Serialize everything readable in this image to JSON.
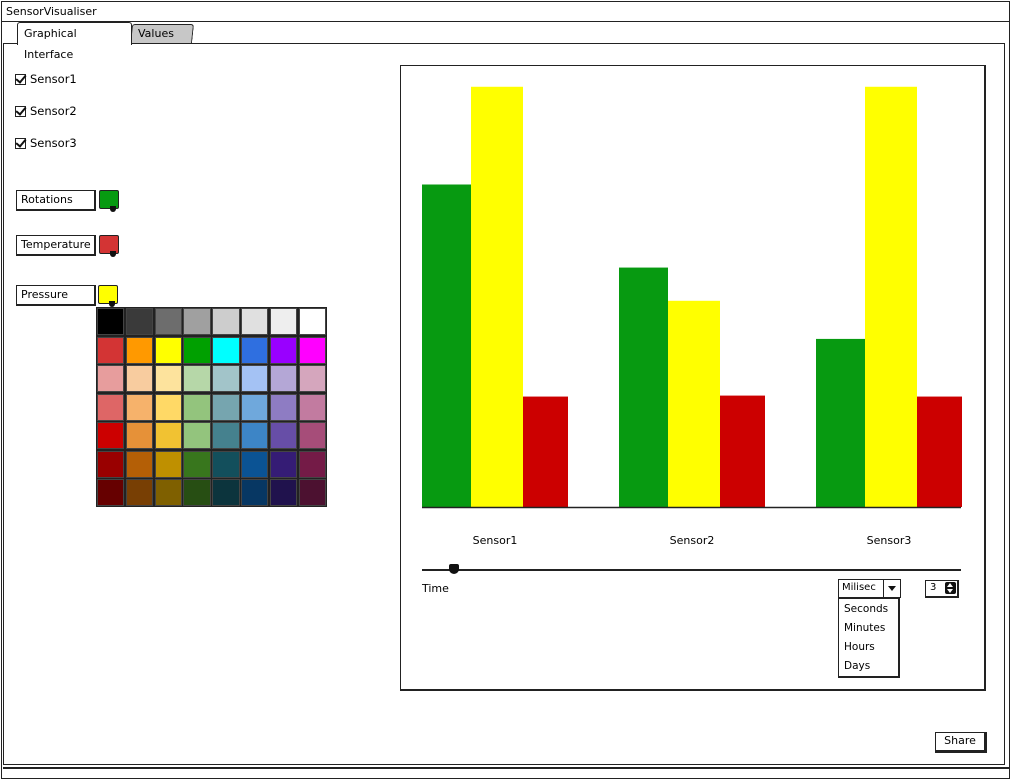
{
  "window": {
    "title": "SensorVisualiser"
  },
  "tabs": [
    {
      "label": "Graphical Interface",
      "active": true
    },
    {
      "label": "Values",
      "active": false
    }
  ],
  "sensors": [
    {
      "label": "Sensor1",
      "checked": true
    },
    {
      "label": "Sensor2",
      "checked": true
    },
    {
      "label": "Sensor3",
      "checked": true
    }
  ],
  "measures": [
    {
      "label": "Rotations",
      "color": "#079a11"
    },
    {
      "label": "Temperature",
      "color": "#d33434"
    },
    {
      "label": "Pressure",
      "color": "#ffff00"
    }
  ],
  "palette": [
    [
      "#000000",
      "#3a3a3a",
      "#6d6d6d",
      "#a0a0a0",
      "#cdcdcd",
      "#e0e0e0",
      "#eeeeee",
      "#ffffff"
    ],
    [
      "#d33434",
      "#ff9900",
      "#ffff00",
      "#00a000",
      "#00ffff",
      "#2f6fe0",
      "#9900ff",
      "#ff00ff"
    ],
    [
      "#e79d9d",
      "#f8cc9f",
      "#fde39d",
      "#b6d7a8",
      "#a2c4c9",
      "#a4c2f4",
      "#b4a7d6",
      "#d5a6bd"
    ],
    [
      "#de6666",
      "#f6b26b",
      "#ffd966",
      "#93c47d",
      "#76a5af",
      "#6fa8dc",
      "#8e7cc3",
      "#c27ba0"
    ],
    [
      "#cc0000",
      "#e69138",
      "#f1c232",
      "#93c47d",
      "#45818e",
      "#3d85c6",
      "#674ea7",
      "#a64d79"
    ],
    [
      "#990000",
      "#b45f06",
      "#bf9000",
      "#38761d",
      "#134f5c",
      "#0b5394",
      "#351c75",
      "#741b47"
    ],
    [
      "#660000",
      "#783f04",
      "#7f6000",
      "#274e13",
      "#0c343d",
      "#073763",
      "#20124d",
      "#4c1130"
    ]
  ],
  "chart_data": {
    "type": "bar",
    "categories": [
      "Sensor1",
      "Sensor2",
      "Sensor3"
    ],
    "series": [
      {
        "color": "#079a11",
        "values": [
          330,
          245,
          172
        ]
      },
      {
        "color": "#ffff00",
        "values": [
          430,
          211,
          430
        ]
      },
      {
        "color": "#cc0000",
        "values": [
          113,
          114,
          113
        ]
      }
    ],
    "ylim": [
      0,
      440
    ],
    "grid": false
  },
  "slider": {
    "label": "Time",
    "value": 0.06
  },
  "time_unit": {
    "selected": "Milisec",
    "options": [
      "Seconds",
      "Minutes",
      "Hours",
      "Days"
    ]
  },
  "stepper": {
    "value": "3"
  },
  "share": {
    "label": "Share"
  }
}
